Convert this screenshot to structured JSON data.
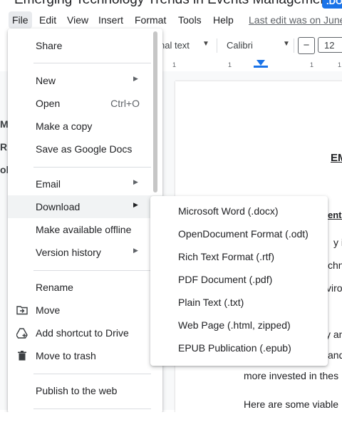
{
  "doc": {
    "title": "Emerging Technology Trends in Events Management",
    "badge": ".DOCX"
  },
  "menubar": {
    "items": [
      "File",
      "Edit",
      "View",
      "Insert",
      "Format",
      "Tools",
      "Help"
    ],
    "last_edit": "Last edit was on June"
  },
  "toolbar": {
    "style_value": "nal text",
    "font_value": "Calibri",
    "minus": "−",
    "font_size": "12"
  },
  "ruler": {
    "ticks": [
      "1",
      "1",
      "1",
      "1"
    ]
  },
  "left_strip": [
    "MI",
    "R",
    "ol"
  ],
  "document": {
    "heading": "EM",
    "subheading": "ente",
    "lines": [
      "y in",
      "chno",
      "viro",
      "y an",
      "and",
      "more invested in thes",
      "Here are some viable"
    ]
  },
  "file_menu": {
    "items": [
      {
        "label": "Share",
        "shortcut": "",
        "submenu": false,
        "icon": ""
      },
      {
        "label": "New",
        "shortcut": "",
        "submenu": true,
        "icon": ""
      },
      {
        "label": "Open",
        "shortcut": "Ctrl+O",
        "submenu": false,
        "icon": ""
      },
      {
        "label": "Make a copy",
        "shortcut": "",
        "submenu": false,
        "icon": ""
      },
      {
        "label": "Save as Google Docs",
        "shortcut": "",
        "submenu": false,
        "icon": ""
      },
      {
        "label": "Email",
        "shortcut": "",
        "submenu": true,
        "icon": ""
      },
      {
        "label": "Download",
        "shortcut": "",
        "submenu": true,
        "icon": ""
      },
      {
        "label": "Make available offline",
        "shortcut": "",
        "submenu": false,
        "icon": ""
      },
      {
        "label": "Version history",
        "shortcut": "",
        "submenu": true,
        "icon": ""
      },
      {
        "label": "Rename",
        "shortcut": "",
        "submenu": false,
        "icon": ""
      },
      {
        "label": "Move",
        "shortcut": "",
        "submenu": false,
        "icon": "move-icon"
      },
      {
        "label": "Add shortcut to Drive",
        "shortcut": "",
        "submenu": false,
        "icon": "add-shortcut-icon"
      },
      {
        "label": "Move to trash",
        "shortcut": "",
        "submenu": false,
        "icon": "trash-icon"
      },
      {
        "label": "Publish to the web",
        "shortcut": "",
        "submenu": false,
        "icon": ""
      }
    ]
  },
  "download_submenu": {
    "items": [
      "Microsoft Word (.docx)",
      "OpenDocument Format (.odt)",
      "Rich Text Format (.rtf)",
      "PDF Document (.pdf)",
      "Plain Text (.txt)",
      "Web Page (.html, zipped)",
      "EPUB Publication (.epub)"
    ]
  },
  "colors": {
    "accent": "#1a73e8",
    "highlight": "#f1f3f4",
    "separator": "#dadce0"
  }
}
